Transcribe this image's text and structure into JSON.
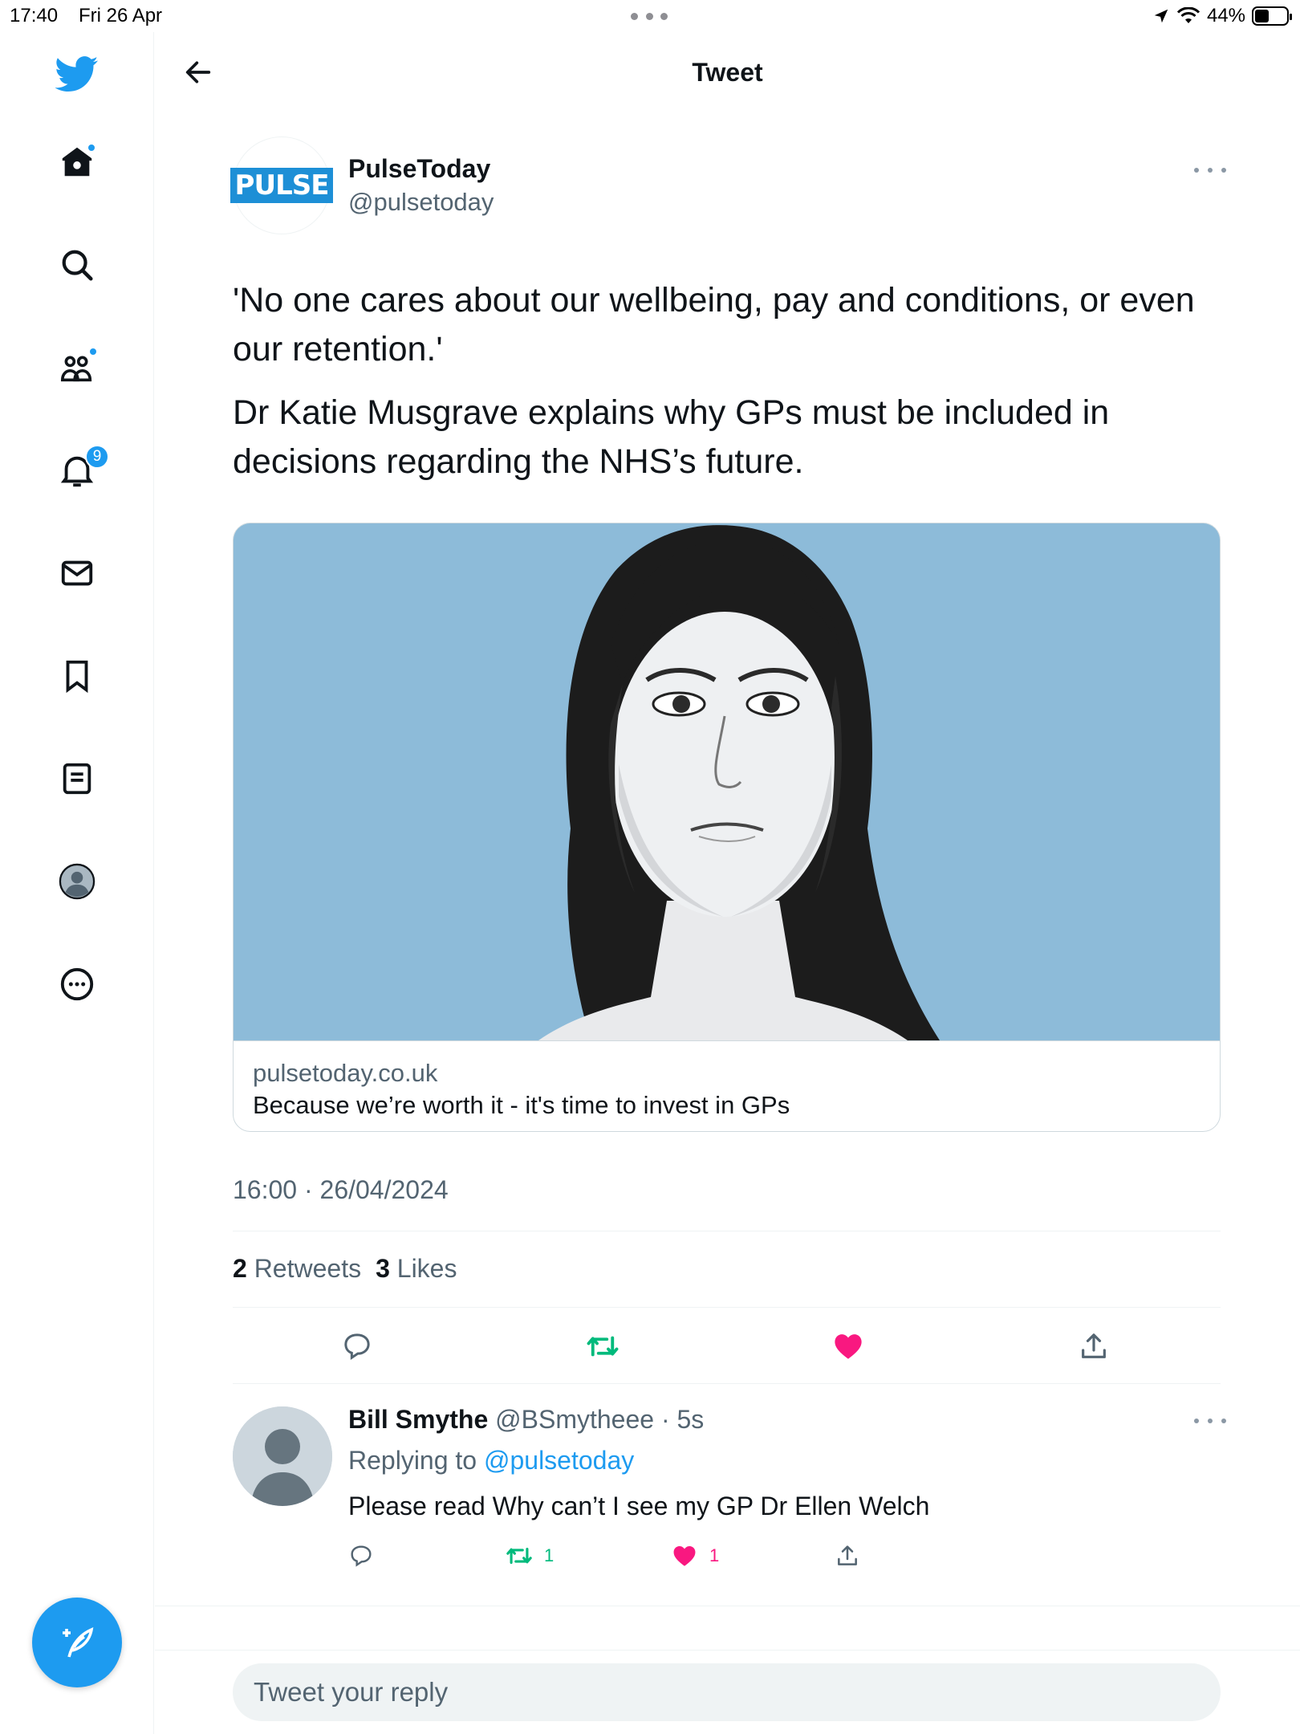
{
  "status_bar": {
    "time": "17:40",
    "date": "Fri 26 Apr",
    "battery": "44%"
  },
  "sidebar": {
    "items": [
      {
        "name": "home",
        "has_dot": true
      },
      {
        "name": "explore"
      },
      {
        "name": "communities",
        "has_dot": true
      },
      {
        "name": "notifications",
        "badge": "9"
      },
      {
        "name": "messages"
      },
      {
        "name": "bookmarks"
      },
      {
        "name": "lists"
      },
      {
        "name": "profile"
      },
      {
        "name": "more"
      }
    ],
    "accent": "#1d9bf0"
  },
  "header": {
    "title": "Tweet"
  },
  "tweet": {
    "author_name": "PulseToday",
    "author_handle": "@pulsetoday",
    "avatar_logo_text": "PULSE",
    "text_para1": "'No one cares about our wellbeing, pay and conditions, or even our retention.'",
    "text_para2": "Dr Katie Musgrave explains why GPs must be included in decisions regarding the NHS’s future.",
    "card": {
      "domain": "pulsetoday.co.uk",
      "title": "Because we’re worth it - it's time to invest in GPs",
      "image_bg": "#8dbbd9"
    },
    "timestamp": "16:00 · 26/04/2024",
    "retweets_count": "2",
    "retweets_label": "Retweets",
    "likes_count": "3",
    "likes_label": "Likes",
    "retweeted": true,
    "liked": true
  },
  "reply": {
    "name": "Bill Smythe",
    "handle_time": "@BSmytheee · 5s",
    "replying_prefix": "Replying to",
    "replying_to": "@pulsetoday",
    "text": "Please read Why can’t I see my GP Dr Ellen Welch",
    "retweet_count": "1",
    "like_count": "1"
  },
  "compose_reply": {
    "placeholder": "Tweet your reply"
  },
  "colors": {
    "retweet_green": "#00ba7c",
    "like_pink": "#f91880",
    "secondary_text": "#536471"
  }
}
